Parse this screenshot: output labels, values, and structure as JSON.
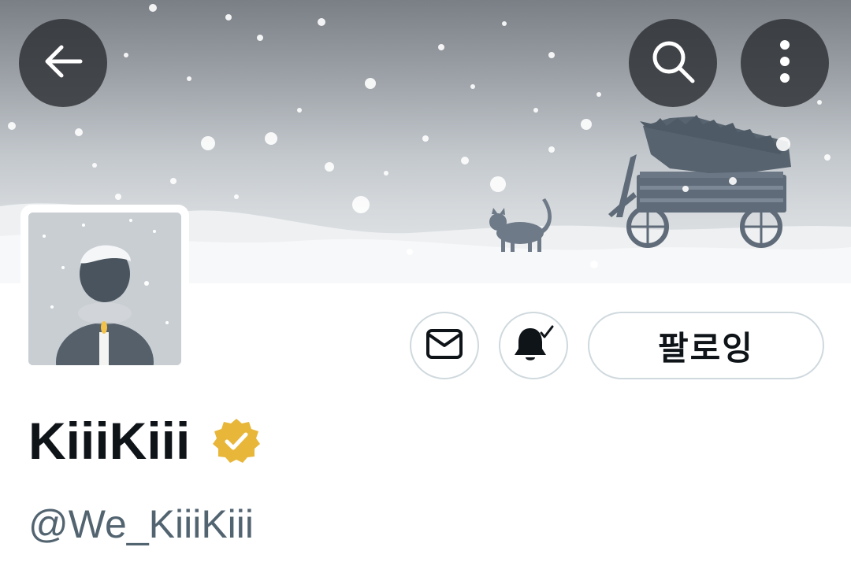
{
  "header": {
    "back_icon": "arrow-left-icon",
    "search_icon": "search-icon",
    "more_icon": "more-vertical-icon"
  },
  "profile": {
    "display_name": "KiiiKiii",
    "handle": "@We_KiiiKiii",
    "verified": true,
    "verified_badge_color": "#e8b73a"
  },
  "actions": {
    "message_icon": "envelope-icon",
    "notify_icon": "bell-check-icon",
    "follow_label": "팔로잉"
  },
  "colors": {
    "text_primary": "#0f1419",
    "text_secondary": "#536471",
    "button_border": "#cfd9de"
  }
}
